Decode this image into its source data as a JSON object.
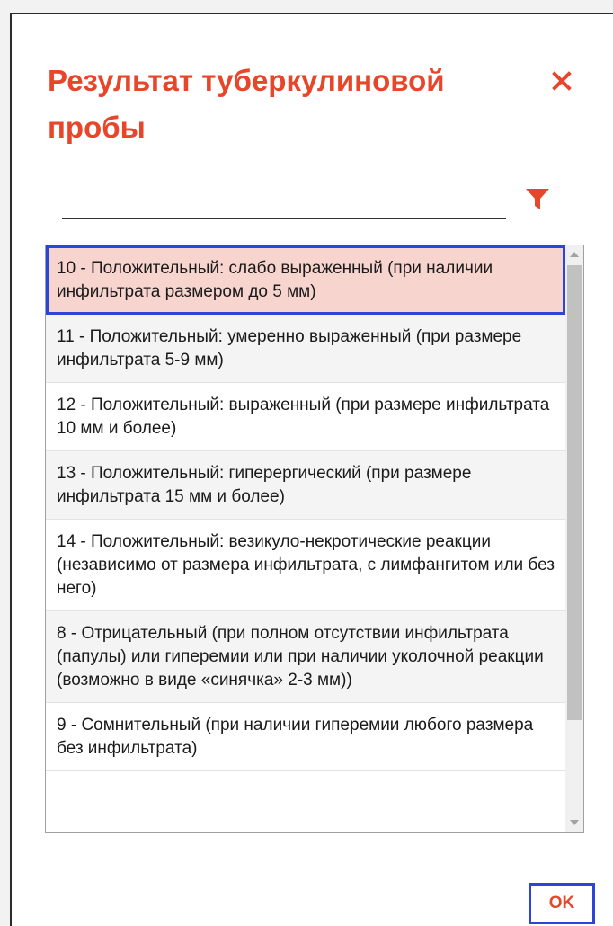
{
  "dialog": {
    "title": "Результат туберкулиновой пробы",
    "close_icon": "close-icon",
    "accent_color": "#e8462a"
  },
  "filter": {
    "value": "",
    "icon": "filter-icon"
  },
  "list": {
    "selected_index": 0,
    "items": [
      "10 - Положительный: слабо выраженный (при наличии инфильтрата размером до 5 мм)",
      "11 - Положительный: умеренно выраженный (при размере инфильтрата 5-9 мм)",
      "12 - Положительный: выраженный (при размере инфильтрата 10 мм и более)",
      "13 - Положительный: гиперергический (при размере инфильтрата 15 мм и более)",
      "14 - Положительный: везикуло-некротические реакции (независимо от размера инфильтрата, с лимфангитом или без него)",
      "8 - Отрицательный (при полном отсутствии инфильтрата (папулы) или гиперемии или при наличии уколочной реакции (возможно в виде «синячка» 2-3 мм))",
      "9 - Сомнительный (при наличии гиперемии любого размера без инфильтрата)"
    ]
  },
  "footer": {
    "ok_label": "OK"
  }
}
